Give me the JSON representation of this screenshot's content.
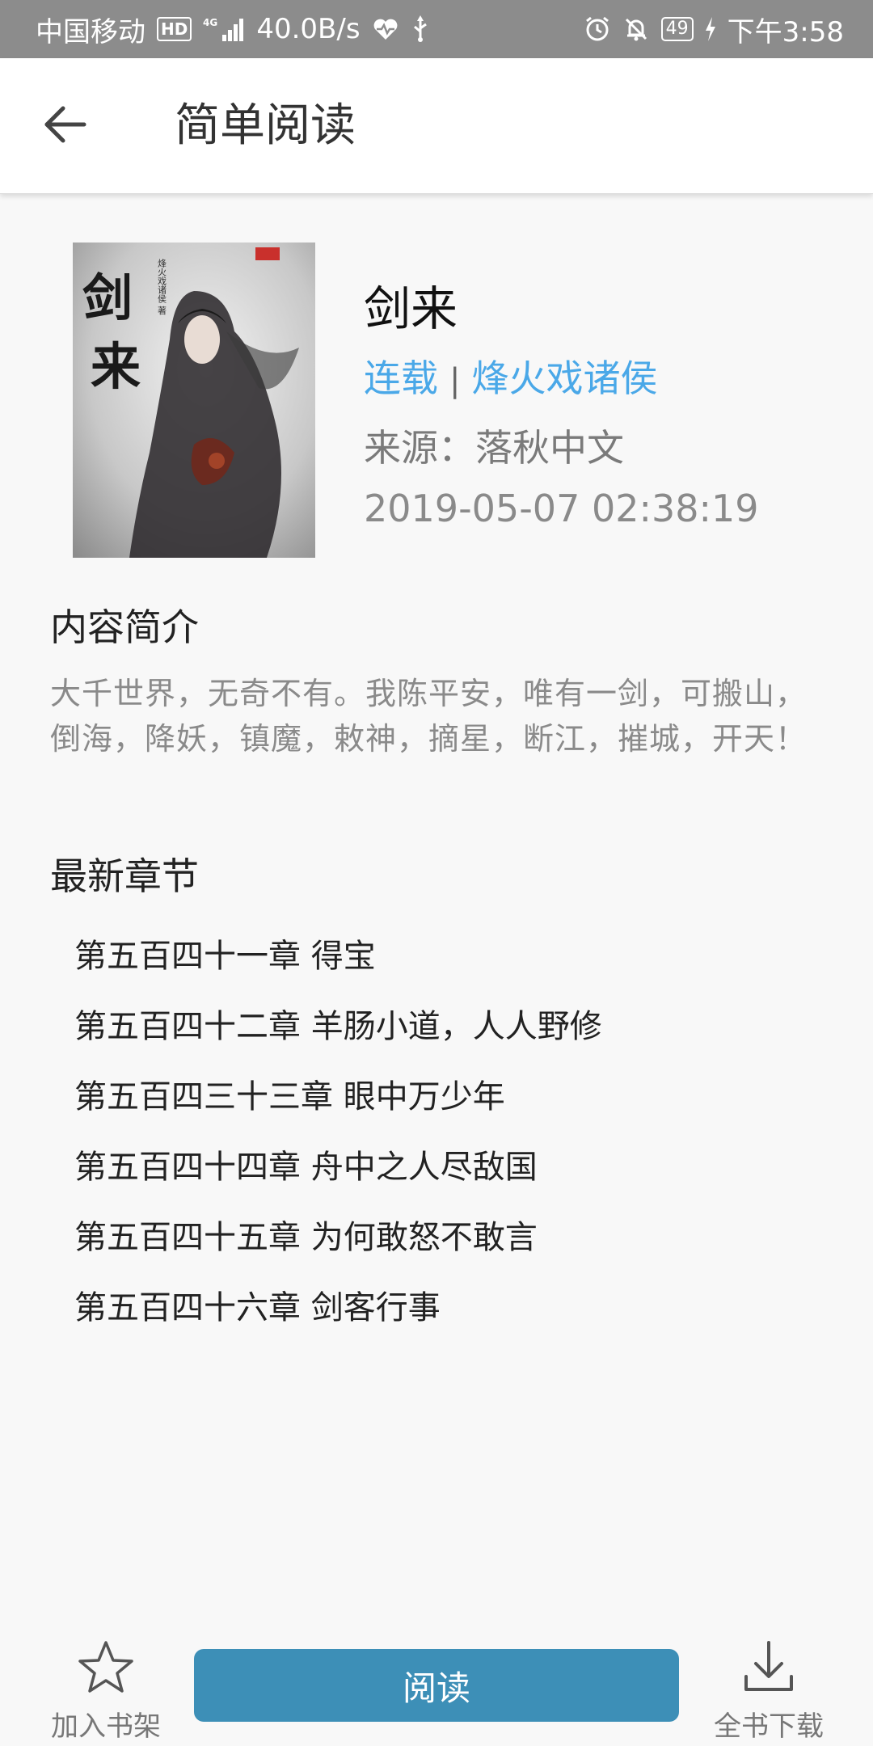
{
  "status_bar": {
    "carrier": "中国移动",
    "hd": "HD",
    "network": "4G",
    "speed": "40.0B/s",
    "battery": "49",
    "time": "下午3:58"
  },
  "app_bar": {
    "title": "简单阅读",
    "back_icon": "arrow-left-icon"
  },
  "book": {
    "cover_title_text": "剑来",
    "cover_author_text": "烽火戏诸侯 著",
    "title": "剑来",
    "status": "连载",
    "separator": "|",
    "author": "烽火戏诸侯",
    "source_label": "来源：",
    "source": "落秋中文",
    "updated": "2019-05-07 02:38:19"
  },
  "summary": {
    "heading": "内容简介",
    "text": "大千世界，无奇不有。我陈平安，唯有一剑，可搬山，倒海，降妖，镇魔，敕神，摘星，断江，摧城，开天！"
  },
  "chapters": {
    "heading": "最新章节",
    "items": [
      "第五百四十一章 得宝",
      "第五百四十二章 羊肠小道，人人野修",
      "第五百四三十三章 眼中万少年",
      "第五百四十四章 舟中之人尽敌国",
      "第五百四十五章 为何敢怒不敢言",
      "第五百四十六章 剑客行事"
    ]
  },
  "bottom_bar": {
    "add_shelf_label": "加入书架",
    "add_shelf_icon": "star-icon",
    "read_label": "阅读",
    "download_label": "全书下载",
    "download_icon": "download-icon"
  },
  "colors": {
    "accent_blue": "#4aa8e8",
    "read_button": "#3d8fb7",
    "status_bar": "#8c8c8c"
  }
}
